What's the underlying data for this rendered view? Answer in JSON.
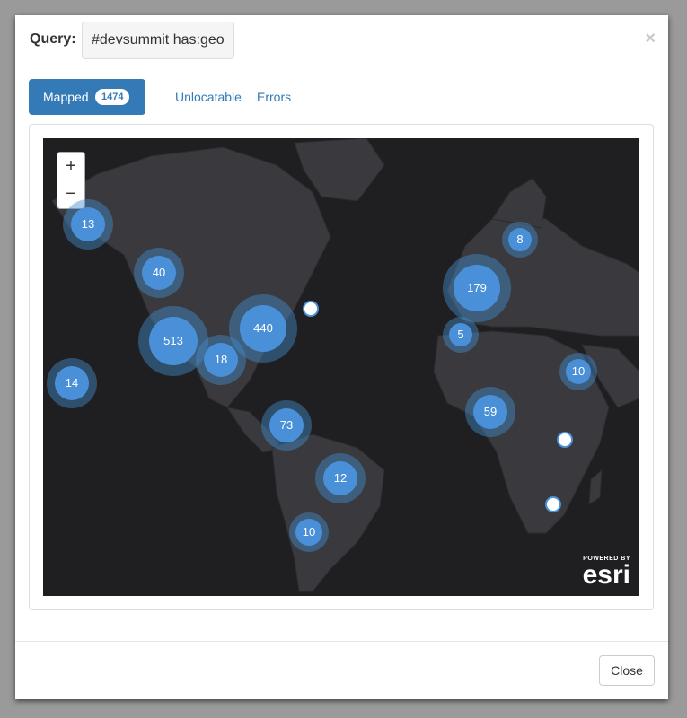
{
  "header": {
    "query_label": "Query:",
    "query_value": "#devsummit has:geo",
    "close_symbol": "×"
  },
  "tabs": [
    {
      "label": "Mapped",
      "badge": "1474",
      "active": true
    },
    {
      "label": "Unlocatable",
      "active": false
    },
    {
      "label": "Errors",
      "active": false
    }
  ],
  "map": {
    "zoom_in": "+",
    "zoom_out": "−",
    "clusters": [
      "13",
      "40",
      "513",
      "440",
      "18",
      "14",
      "73",
      "12",
      "10",
      "8",
      "179",
      "5",
      "10",
      "59"
    ],
    "logo_powered_by": "POWERED BY",
    "logo_word": "esri"
  },
  "footer": {
    "close_label": "Close"
  },
  "colors": {
    "accent": "#337ab7",
    "cluster": "#4a90d9",
    "map_bg": "#1f1f22"
  }
}
